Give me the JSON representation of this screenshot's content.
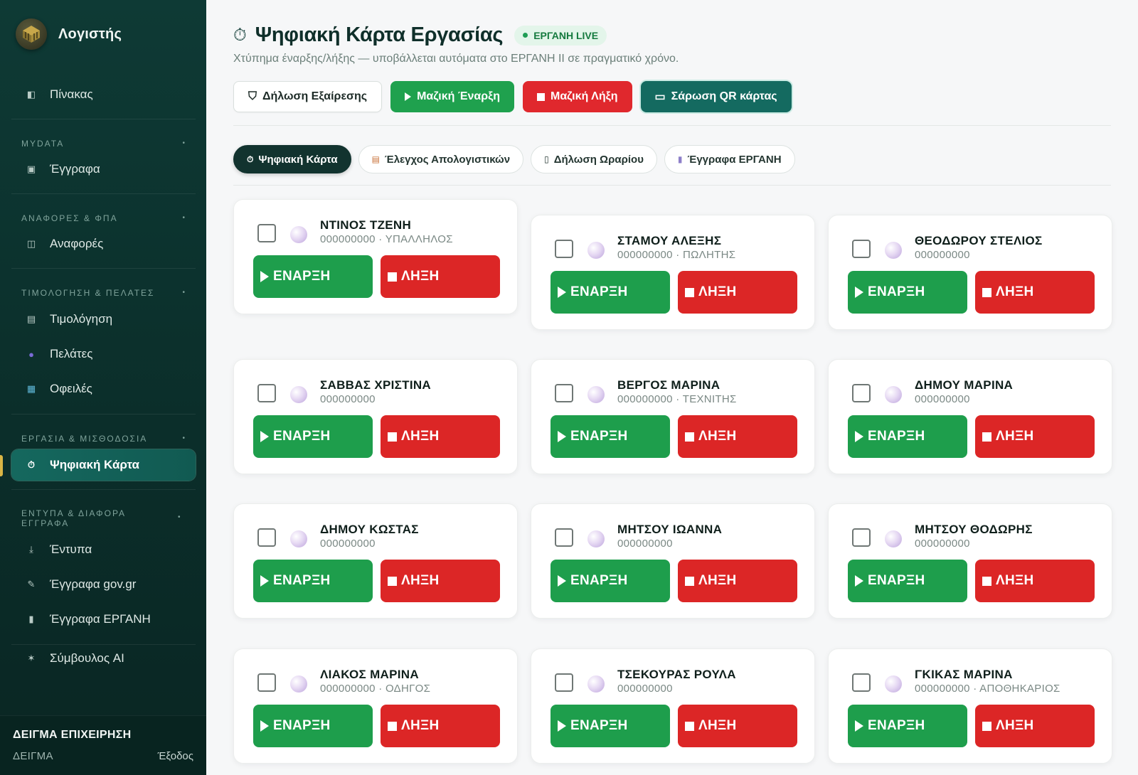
{
  "app": {
    "name": "Λογιστής"
  },
  "sidebar": {
    "dashboard": {
      "label": "Πίνακας"
    },
    "sections": [
      {
        "title": "MYDATA",
        "items": [
          {
            "label": "Έγγραφα"
          }
        ]
      },
      {
        "title": "ΑΝΑΦΟΡΕΣ & ΦΠΑ",
        "items": [
          {
            "label": "Αναφορές"
          }
        ]
      },
      {
        "title": "ΤΙΜΟΛΟΓΗΣΗ & ΠΕΛΑΤΕΣ",
        "items": [
          {
            "label": "Τιμολόγηση"
          },
          {
            "label": "Πελάτες"
          },
          {
            "label": "Οφειλές"
          }
        ]
      },
      {
        "title": "ΕΡΓΑΣΙΑ & ΜΙΣΘΟΔΟΣΙΑ",
        "items": [
          {
            "label": "Ψηφιακή Κάρτα"
          }
        ]
      },
      {
        "title": "ΕΝΤΥΠΑ & ΔΙΑΦΟΡΑ ΕΓΓΡΑΦΑ",
        "items": [
          {
            "label": "Έντυπα"
          },
          {
            "label": "Έγγραφα gov.gr"
          },
          {
            "label": "Έγγραφα ΕΡΓΑΝΗ"
          }
        ]
      }
    ],
    "ai": {
      "label": "Σύμβουλος AI"
    },
    "footer": {
      "company": "ΔΕΙΓΜΑ ΕΠΙΧΕΙΡΗΣΗ",
      "user": "ΔΕΙΓΜΑ",
      "logout": "Έξοδος"
    }
  },
  "header": {
    "title": "Ψηφιακή Κάρτα Εργασίας",
    "badge": "ΕΡΓΑΝΗ LIVE",
    "subtitle": "Χτύπημα έναρξης/λήξης — υποβάλλεται αυτόματα στο ΕΡΓΑΝΗ ΙΙ σε πραγματικό χρόνο."
  },
  "actions": {
    "exception": "Δήλωση Εξαίρεσης",
    "bulk_start": "Μαζική Έναρξη",
    "bulk_stop": "Μαζική Λήξη",
    "scan_qr": "Σάρωση QR κάρτας"
  },
  "tabs": [
    {
      "label": "Ψηφιακή Κάρτα",
      "icon": "stopwatch-icon"
    },
    {
      "label": "Έλεγχος Απολογιστικών",
      "icon": "clipboard-icon"
    },
    {
      "label": "Δήλωση Ωραρίου",
      "icon": "schedule-icon"
    },
    {
      "label": "Έγγραφα ΕΡΓΑΝΗ",
      "icon": "document-icon"
    }
  ],
  "card_buttons": {
    "start": "ΕΝΑΡΞΗ",
    "stop": "ΛΗΞΗ"
  },
  "employees": [
    {
      "name": "ΝΤΙΝΟΣ ΤΖΕΝΗ",
      "meta": "000000000 · ΥΠΑΛΛΗΛΟΣ"
    },
    {
      "name": "ΣΤΑΜΟΥ ΑΛΕΞΗΣ",
      "meta": "000000000 · ΠΩΛΗΤΗΣ"
    },
    {
      "name": "ΘΕΟΔΩΡΟΥ ΣΤΕΛΙΟΣ",
      "meta": "000000000"
    },
    {
      "name": "ΣΑΒΒΑΣ ΧΡΙΣΤΙΝΑ",
      "meta": "000000000"
    },
    {
      "name": "ΒΕΡΓΟΣ ΜΑΡΙΝΑ",
      "meta": "000000000 · ΤΕΧΝΙΤΗΣ"
    },
    {
      "name": "ΔΗΜΟΥ ΜΑΡΙΝΑ",
      "meta": "000000000"
    },
    {
      "name": "ΔΗΜΟΥ ΚΩΣΤΑΣ",
      "meta": "000000000"
    },
    {
      "name": "ΜΗΤΣΟΥ ΙΩΑΝΝΑ",
      "meta": "000000000"
    },
    {
      "name": "ΜΗΤΣΟΥ ΘΟΔΩΡΗΣ",
      "meta": "000000000"
    },
    {
      "name": "ΛΙΑΚΟΣ ΜΑΡΙΝΑ",
      "meta": "000000000 · ΟΔΗΓΟΣ"
    },
    {
      "name": "ΤΣΕΚΟΥΡΑΣ ΡΟΥΛΑ",
      "meta": "000000000"
    },
    {
      "name": "ΓΚΙΚΑΣ ΜΑΡΙΝΑ",
      "meta": "000000000 · ΑΠΟΘΗΚΑΡΙΟΣ"
    }
  ],
  "colors": {
    "start": "#1e9e4c",
    "stop": "#dc2626",
    "sidebar": "#0e3a35",
    "accent": "#146a60"
  }
}
